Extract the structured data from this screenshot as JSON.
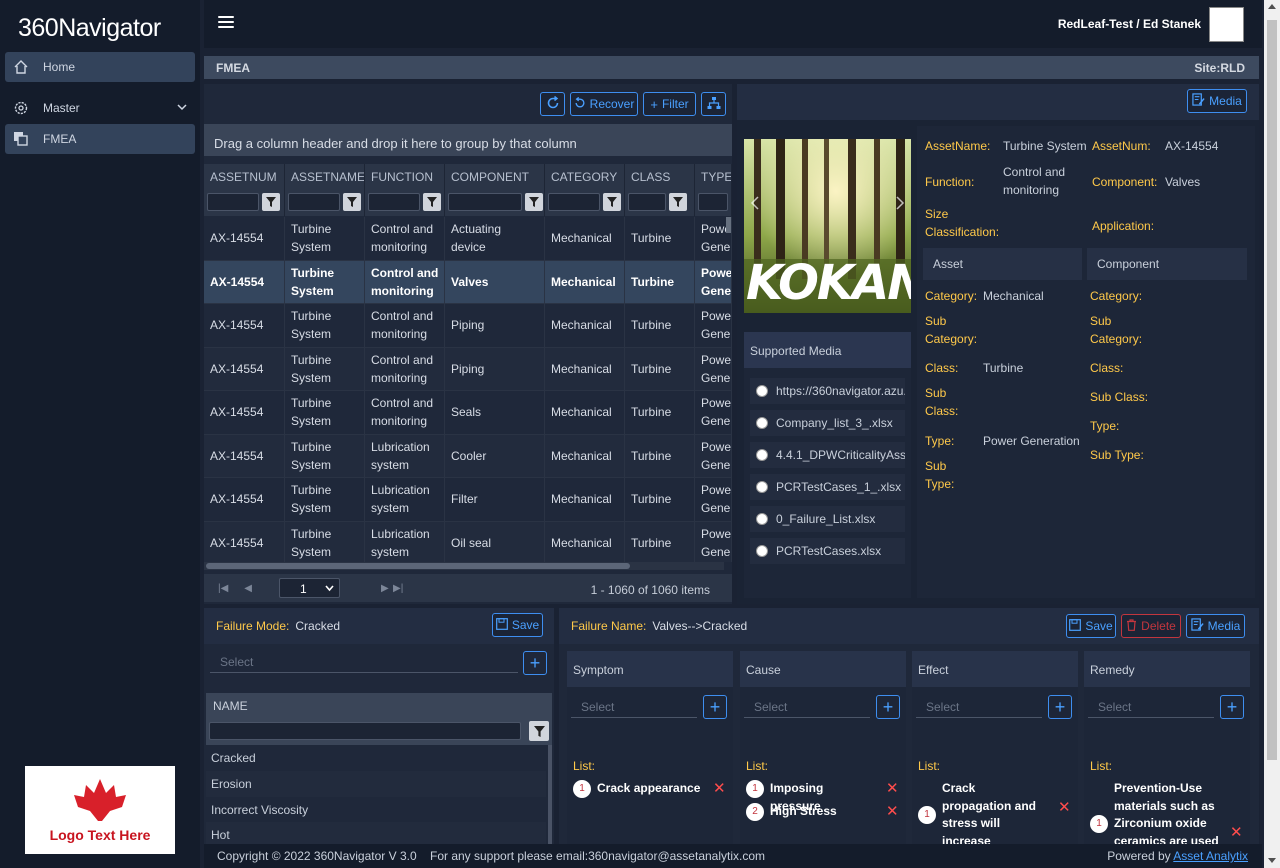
{
  "app": {
    "logo_num": "360",
    "logo_text": "Navigator",
    "user": "RedLeaf-Test / Ed Stanek",
    "page": "FMEA",
    "site": "Site:RLD"
  },
  "sidebar": {
    "items": [
      {
        "label": "Home"
      },
      {
        "label": "Master"
      },
      {
        "label": "FMEA"
      }
    ],
    "logo_text": "Logo Text Here"
  },
  "grid": {
    "buttons": {
      "recover": "Recover",
      "filter": "Filter"
    },
    "group_hint": "Drag a column header and drop it here to group by that column",
    "columns": [
      "ASSETNUM",
      "ASSETNAME",
      "FUNCTION",
      "COMPONENT",
      "CATEGORY",
      "CLASS",
      "TYPE"
    ],
    "rows": [
      [
        "AX-14554",
        "Turbine System",
        "Control and monitoring",
        "Actuating device",
        "Mechanical",
        "Turbine",
        "Power Generation"
      ],
      [
        "AX-14554",
        "Turbine System",
        "Control and monitoring",
        "Valves",
        "Mechanical",
        "Turbine",
        "Power Generation"
      ],
      [
        "AX-14554",
        "Turbine System",
        "Control and monitoring",
        "Piping",
        "Mechanical",
        "Turbine",
        "Power Generation"
      ],
      [
        "AX-14554",
        "Turbine System",
        "Control and monitoring",
        "Piping",
        "Mechanical",
        "Turbine",
        "Power Generation"
      ],
      [
        "AX-14554",
        "Turbine System",
        "Control and monitoring",
        "Seals",
        "Mechanical",
        "Turbine",
        "Power Generation"
      ],
      [
        "AX-14554",
        "Turbine System",
        "Lubrication system",
        "Cooler",
        "Mechanical",
        "Turbine",
        "Power Generation"
      ],
      [
        "AX-14554",
        "Turbine System",
        "Lubrication system",
        "Filter",
        "Mechanical",
        "Turbine",
        "Power Generation"
      ],
      [
        "AX-14554",
        "Turbine System",
        "Lubrication system",
        "Oil seal",
        "Mechanical",
        "Turbine",
        "Power Generation"
      ]
    ],
    "selected_row": 1,
    "page": "1",
    "page_info": "1 - 1060 of 1060 items"
  },
  "asset": {
    "media_button": "Media",
    "image_text": "KOKAN",
    "supported_media_title": "Supported Media",
    "media_files": [
      "https://360navigator.azu...",
      "Company_list_3_.xlsx",
      "4.4.1_DPWCriticalityAsse...",
      "PCRTestCases_1_.xlsx",
      "0_Failure_List.xlsx",
      "PCRTestCases.xlsx"
    ],
    "labels": {
      "asset_name": "AssetName:",
      "asset_num": "AssetNum:",
      "function": "Function:",
      "component": "Component:",
      "size_class": "Size Classification:",
      "application": "Application:",
      "category": "Category:",
      "sub_category": "Sub Category:",
      "class": "Class:",
      "sub_class": "Sub Class:",
      "type": "Type:",
      "sub_type": "Sub Type:"
    },
    "values": {
      "asset_name": "Turbine System",
      "asset_num": "AX-14554",
      "function": "Control and monitoring",
      "component": "Valves",
      "category": "Mechanical",
      "class": "Turbine",
      "type": "Power Generation"
    },
    "sections": {
      "asset": "Asset",
      "component": "Component"
    }
  },
  "failure_mode": {
    "label": "Failure Mode:",
    "value": "Cracked",
    "save": "Save",
    "select_placeholder": "Select",
    "name_header": "NAME",
    "names": [
      "Cracked",
      "Erosion",
      "Incorrect Viscosity",
      "Hot"
    ]
  },
  "failure_name": {
    "label": "Failure Name:",
    "value": "Valves-->Cracked",
    "save": "Save",
    "delete": "Delete",
    "media": "Media",
    "select_placeholder": "Select",
    "list_label": "List:",
    "cards": [
      {
        "title": "Symptom",
        "items": [
          "Crack appearance"
        ]
      },
      {
        "title": "Cause",
        "items": [
          "Imposing pressure",
          "High Stress"
        ]
      },
      {
        "title": "Effect",
        "items": [
          "Crack propagation and stress will increase"
        ]
      },
      {
        "title": "Remedy",
        "items": [
          "Prevention-Use materials such as Zirconium oxide ceramics are used for"
        ]
      }
    ]
  },
  "footer": {
    "copyright": "Copyright © 2022 360Navigator V 3.0",
    "support": "For any support please email:360navigator@assetanalytix.com",
    "powered_by": "Powered by",
    "powered_link": "Asset Analytix"
  }
}
